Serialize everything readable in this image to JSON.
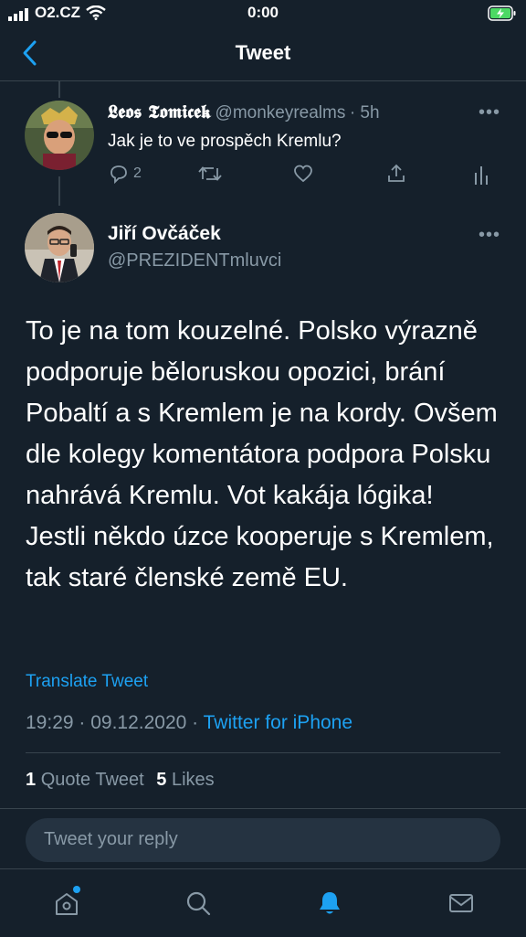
{
  "status_bar": {
    "carrier": "O2.CZ",
    "time": "0:00"
  },
  "nav": {
    "title": "Tweet"
  },
  "reply_tweet": {
    "display_name": "𝕷𝖊𝖔𝖘 𝕿𝖔𝖒𝖎𝖈𝖊𝖐",
    "handle": "@monkeyrealms",
    "age": "· 5h",
    "text": "Jak je to ve prospěch Kremlu?",
    "reply_count": "2"
  },
  "main_tweet": {
    "display_name": "Jiří Ovčáček",
    "handle": "@PREZIDENTmluvci",
    "text": "To je na tom kouzelné. Polsko výrazně podporuje běloruskou opozici, brání Pobaltí a s Kremlem je na kordy. Ovšem dle kolegy komentátora podpora Polsku nahrává Kremlu. Vot kakája lógika! Jestli někdo úzce kooperuje s Kremlem, tak staré členské země EU.",
    "translate_label": "Translate Tweet",
    "timestamp": "19:29 · 09.12.2020 ·",
    "source": "Twitter for iPhone",
    "quote_count": "1",
    "quote_label": "Quote Tweet",
    "like_count": "5",
    "like_label": "Likes"
  },
  "reply_input": {
    "placeholder": "Tweet your reply"
  },
  "tabbar": {
    "items": [
      "home-icon",
      "search-icon",
      "notifications-icon",
      "messages-icon"
    ]
  },
  "colors": {
    "background": "#15202b",
    "accent": "#1da1f2",
    "muted": "#8899a6",
    "divider": "#38444d"
  }
}
